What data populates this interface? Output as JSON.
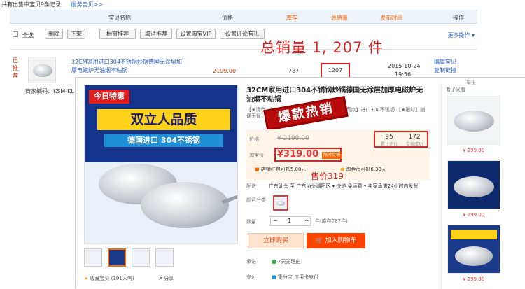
{
  "top": {
    "record_text": "共有出售中宝贝9条记录",
    "service_link": "服务宝贝>>"
  },
  "header": {
    "name": "宝贝名称",
    "price": "价格",
    "stock": "库存",
    "sales": "总销量",
    "date": "发布时间",
    "ops": "操作"
  },
  "toolbar": {
    "select_all": "全选",
    "delete": "删除",
    "unlist": "下架",
    "recommend": "橱窗推荐",
    "cancel_recommend": "取消推荐",
    "vip": "设置淘宝VIP",
    "review": "设置评论有礼",
    "more": "更多操作 ▾"
  },
  "product_row": {
    "badge": "已推荐",
    "title": "32CM家用进口304不锈钢炒锅德国无涂层加厚电磁炉无油烟不粘锅",
    "price": "2199.00",
    "stock": "787",
    "sales": "1207",
    "date": "2015-10-24",
    "time": "19:56",
    "op_edit": "编辑宝贝",
    "op_copy": "复制链接",
    "code": "商家编码：KSM-KL"
  },
  "annotation_total": "总销量 1, 207 件",
  "page": {
    "report": "举报",
    "title": "32CM家用进口304不锈钢炒锅德国无涂层加厚电磁炉无油烟不粘锅",
    "desc": "【★清仓…】进口304不锈钢 德国无涂层 【★高点】进口304不锈钢 【★限时】随便无忧，售后无忧，赠送10年",
    "stamp": "爆款热销",
    "image": {
      "tag": "今日特惠",
      "slogan": "双立人品质",
      "sub": "德国进口 304不锈钢"
    },
    "price_label": "价格",
    "original_price": "¥ 2199.00",
    "stats": [
      {
        "value": "95",
        "label": "累计评价"
      },
      {
        "value": "172",
        "label": "交易成功"
      }
    ],
    "taobao_price_label": "淘宝价",
    "current_price": "¥319.00",
    "promo_tag": "限时促销",
    "shop_coupon": "店铺红包可抵5.00元",
    "coin": "淘金币可抵6.38元",
    "sold_note": "售价319",
    "ship_label": "配送",
    "ship_value": "广东汕头 至 广东汕头潮阳区 ▾  快递 免运费 ▾   卖家承诺24小时内发货",
    "color_label": "颜色分类",
    "qty_label": "数量",
    "qty_value": "1",
    "stock_text": "件(库存787件)",
    "buy_now": "立即购买",
    "add_cart": "加入购物车",
    "promise_label": "承诺",
    "promise_value": "7天无理由",
    "pay_label": "支付",
    "pay_value": "集分宝        信用卡支付",
    "fav": "收藏宝贝 (191人气)",
    "share": "分享"
  },
  "side": {
    "title": "看了又看",
    "items": [
      {
        "price": "¥ 299.00"
      },
      {
        "price": "¥ 299.00"
      },
      {
        "price": "¥ 299.00"
      }
    ]
  }
}
